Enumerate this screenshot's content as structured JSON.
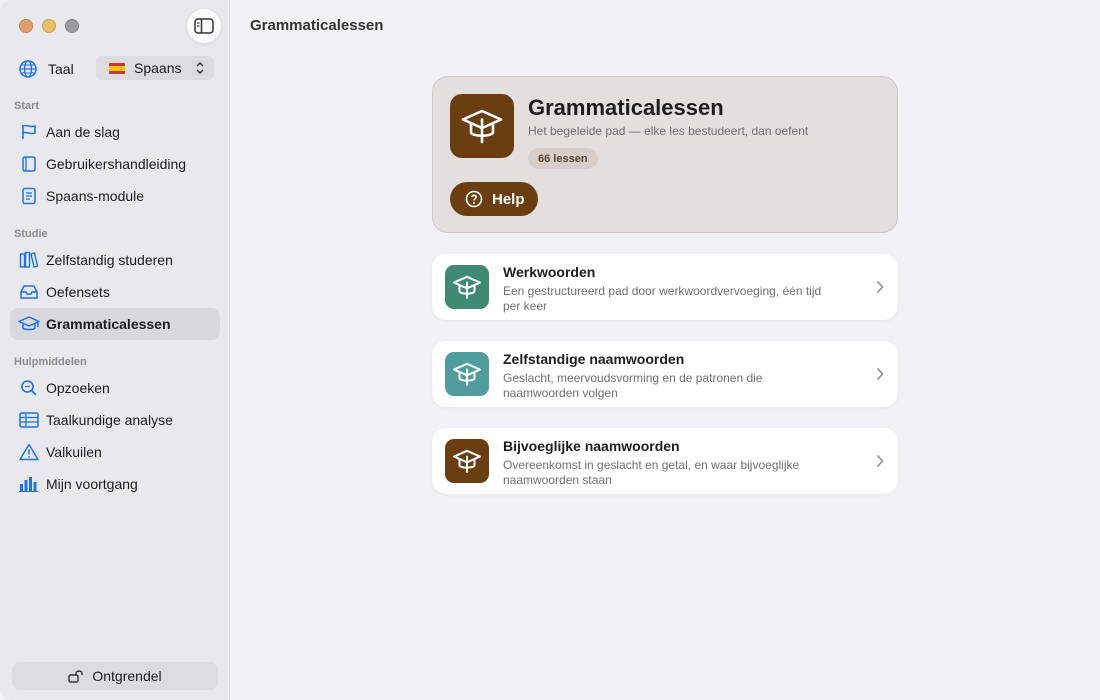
{
  "window": {
    "title": "Grammaticalessen"
  },
  "sidebar": {
    "language_label": "Taal",
    "language_value": "Spaans",
    "sections": {
      "start": "Start",
      "study": "Studie",
      "tools": "Hulpmiddelen"
    },
    "items": [
      {
        "label": "Aan de slag",
        "icon": "flag-icon"
      },
      {
        "label": "Gebruikershandleiding",
        "icon": "book-icon"
      },
      {
        "label": "Spaans-module",
        "icon": "document-icon"
      },
      {
        "label": "Zelfstandig studeren",
        "icon": "books-icon"
      },
      {
        "label": "Oefensets",
        "icon": "tray-icon"
      },
      {
        "label": "Grammaticalessen",
        "icon": "graduation-cap-icon",
        "active": true
      },
      {
        "label": "Opzoeken",
        "icon": "magnifier-icon"
      },
      {
        "label": "Taalkundige analyse",
        "icon": "table-icon"
      },
      {
        "label": "Valkuilen",
        "icon": "warning-icon"
      },
      {
        "label": "Mijn voortgang",
        "icon": "chart-icon"
      }
    ],
    "unlock_label": "Ontgrendel"
  },
  "hero": {
    "title": "Grammaticalessen",
    "subtitle": "Het begeleide pad — elke les bestudeert, dan oefent",
    "badge": "66 lessen",
    "help_label": "Help"
  },
  "cards": [
    {
      "title": "Werkwoorden",
      "description": "Een gestructureerd pad door werkwoordvervoeging, één tijd per keer",
      "color": "#3f8a72"
    },
    {
      "title": "Zelfstandige naamwoorden",
      "description": "Geslacht, meervoudsvorming en de patronen die naamwoorden volgen",
      "color": "#4f9d9c"
    },
    {
      "title": "Bijvoeglijke naamwoorden",
      "description": "Overeenkomst in geslacht en getal, en waar bijvoeglijke naamwoorden staan",
      "color": "#6b3e12"
    }
  ],
  "colors": {
    "accent": "#1a73e8",
    "brown": "#6b3e12"
  }
}
